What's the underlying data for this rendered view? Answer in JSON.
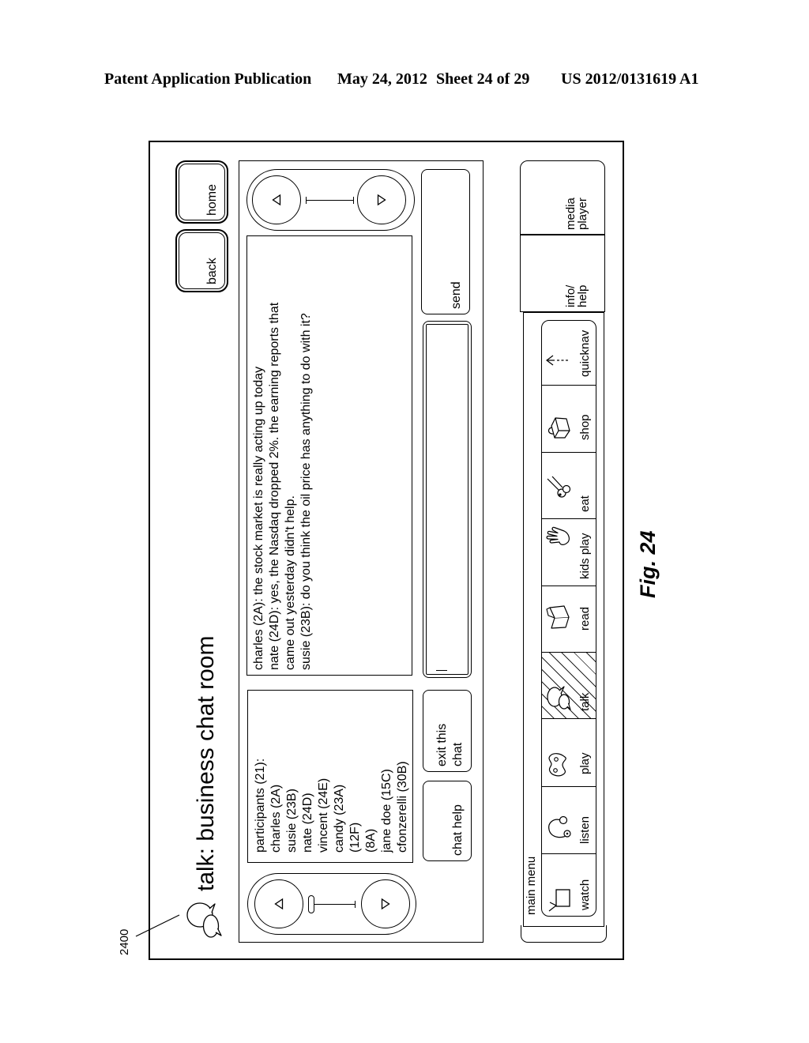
{
  "header": {
    "publication": "Patent Application Publication",
    "date": "May 24, 2012",
    "sheet": "Sheet 24 of 29",
    "patent_number": "US 2012/0131619 A1"
  },
  "figure": {
    "reference_numeral": "2400",
    "caption": "Fig. 24"
  },
  "screen": {
    "title": "talk: business chat room",
    "title_icon": "chat-bubbles-icon",
    "nav": {
      "back": "back",
      "home": "home"
    },
    "participants": {
      "heading": "participants (21):",
      "members": [
        "charles (2A)",
        "susie (23B)",
        "nate (24D)",
        "vincent (24E)",
        "candy (23A)",
        "(12F)",
        "(8A)",
        "jane doe (15C)",
        "cfonzerelli (30B)"
      ],
      "scroller": {
        "up_icon": "triangle-up-icon",
        "down_icon": "triangle-down-icon",
        "position": 0
      }
    },
    "chat_log": {
      "messages": [
        "charles (2A): the stock market is really acting up today",
        "nate (24D): yes, the Nasdaq dropped 2%. the earning reports that came out yesterday didn't help.",
        "susie (23B): do you think the oil price has anything to do with it?"
      ],
      "scroller": {
        "up_icon": "triangle-up-icon",
        "down_icon": "triangle-down-icon"
      }
    },
    "message_input": {
      "value": ""
    },
    "buttons": {
      "chat_help": "chat help",
      "exit_chat": "exit this\nchat",
      "send": "send"
    }
  },
  "main_menu": {
    "label": "main menu",
    "selected": "talk",
    "items": [
      {
        "label": "watch",
        "icon": "tv-icon"
      },
      {
        "label": "listen",
        "icon": "headphones-icon"
      },
      {
        "label": "play",
        "icon": "game-controller-icon"
      },
      {
        "label": "talk",
        "icon": "chat-bubbles-icon"
      },
      {
        "label": "read",
        "icon": "book-icon"
      },
      {
        "label": "kids play",
        "icon": "hand-icon"
      },
      {
        "label": "eat",
        "icon": "food-icon"
      },
      {
        "label": "shop",
        "icon": "shopping-bag-icon"
      },
      {
        "label": "quicknav",
        "icon": "arrow-up-icon"
      }
    ],
    "info_help": "info/\nhelp",
    "media_player": "media\nplayer"
  },
  "colors": {
    "ink": "#000000",
    "paper": "#ffffff"
  }
}
